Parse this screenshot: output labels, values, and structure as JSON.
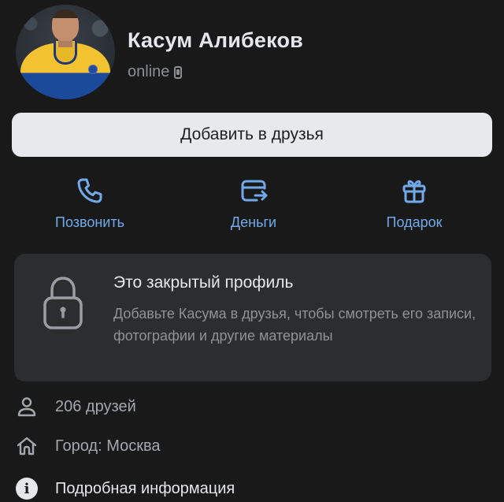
{
  "profile": {
    "name": "Касум Алибеков",
    "status": "online"
  },
  "actions": {
    "add_friend": "Добавить в друзья",
    "call": "Позвонить",
    "money": "Деньги",
    "gift": "Подарок"
  },
  "private": {
    "title": "Это закрытый профиль",
    "text": "Добавьте Касума в друзья, чтобы смотреть его записи, фотографии и другие материалы"
  },
  "info": {
    "friends": "206 друзей",
    "city": "Город: Москва",
    "more": "Подробная информация"
  },
  "colors": {
    "background": "#19191a",
    "accent": "#71aaeb",
    "card": "#2c2d2f",
    "button": "#e8e9ec"
  },
  "icons": [
    "phone-icon",
    "money-card-icon",
    "gift-icon",
    "lock-icon",
    "person-icon",
    "home-icon",
    "info-icon",
    "mobile-device-icon"
  ]
}
